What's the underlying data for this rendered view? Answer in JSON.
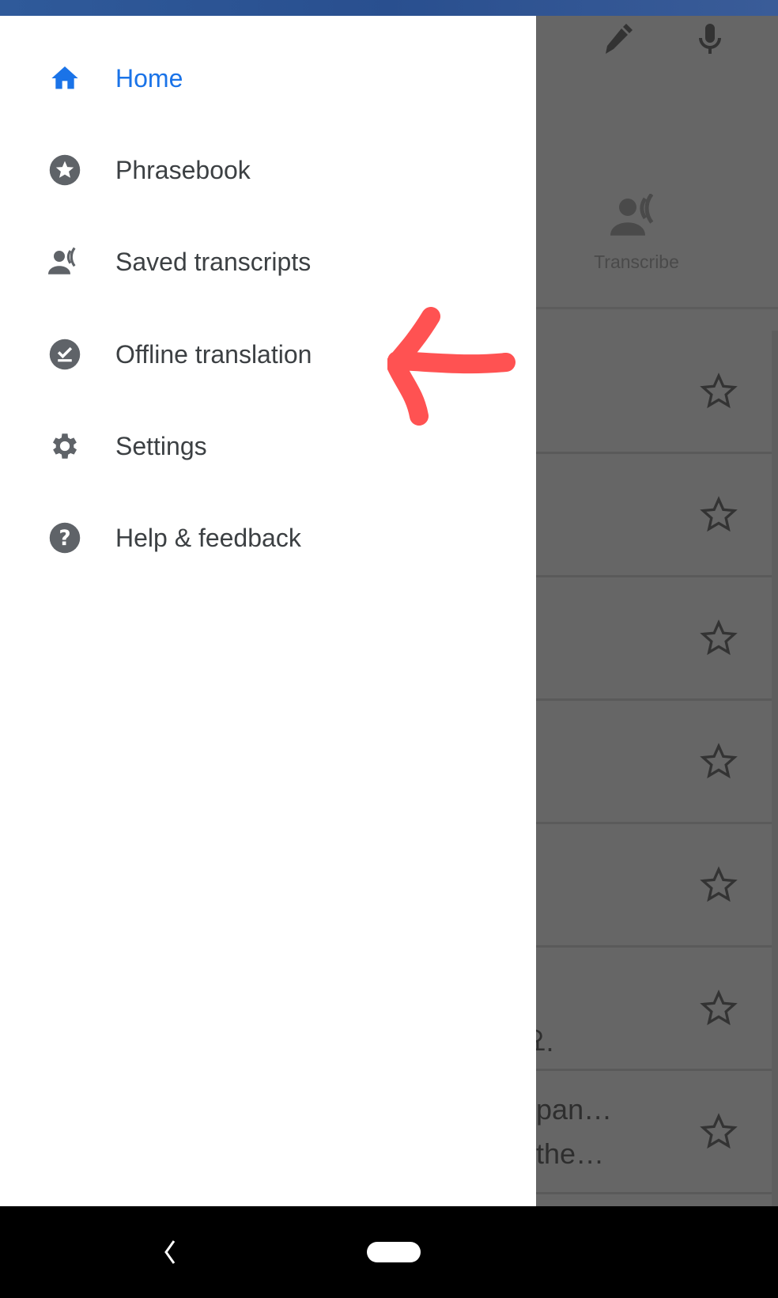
{
  "drawer": {
    "items": [
      {
        "label": "Home",
        "icon": "home-icon",
        "active": true
      },
      {
        "label": "Phrasebook",
        "icon": "star-circle-icon",
        "active": false
      },
      {
        "label": "Saved transcripts",
        "icon": "transcribe-person-icon",
        "active": false
      },
      {
        "label": "Offline translation",
        "icon": "offline-check-icon",
        "active": false
      },
      {
        "label": "Settings",
        "icon": "gear-icon",
        "active": false
      },
      {
        "label": "Help & feedback",
        "icon": "help-icon",
        "active": false
      }
    ]
  },
  "background": {
    "header_icons": [
      "handwriting-pen-icon",
      "microphone-icon"
    ],
    "transcribe_label": "Transcribe",
    "rows": [
      {
        "text": ""
      },
      {
        "text": ""
      },
      {
        "text": ""
      },
      {
        "text": ""
      },
      {
        "text": ""
      },
      {
        "text": "|요."
      },
      {
        "text_line1": "tepan…",
        "text_line2": "n the…"
      }
    ]
  },
  "annotation": {
    "type": "red-arrow",
    "color": "#ff5252",
    "points_to": "Offline translation"
  },
  "colors": {
    "accent": "#1a73e8",
    "icon_gray": "#5f6368",
    "scrim": "#666666"
  }
}
